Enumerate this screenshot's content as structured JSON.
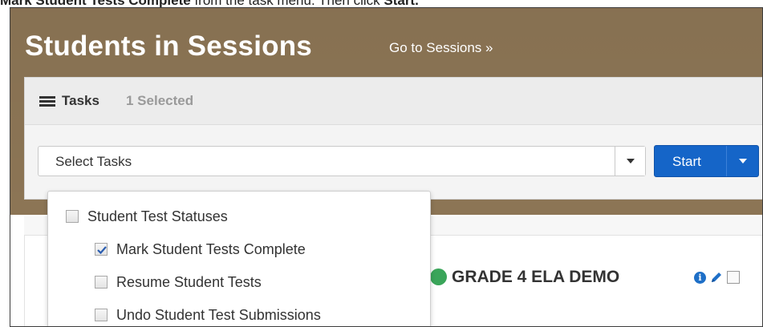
{
  "instruction": {
    "bold": "Mark Student Tests Complete",
    "rest": " from the task menu. Then click ",
    "start_word": "Start."
  },
  "header": {
    "title": "Students in Sessions",
    "link": "Go to Sessions »"
  },
  "tasks": {
    "label": "Tasks",
    "selected_count": "1 Selected",
    "select_placeholder": "Select Tasks",
    "start_label": "Start"
  },
  "menu": {
    "group_label": "Student Test Statuses",
    "items": [
      {
        "label": "Mark Student Tests Complete",
        "checked": true
      },
      {
        "label": "Resume Student Tests",
        "checked": false
      },
      {
        "label": "Undo Student Test Submissions",
        "checked": false
      }
    ]
  },
  "session": {
    "title": "GRADE 4 ELA DEMO",
    "status_color": "#3aa55a"
  },
  "colors": {
    "band": "#8c7555",
    "primary": "#1565c8"
  },
  "icons": {
    "tasks": "list-icon",
    "info": "info-icon",
    "edit": "pencil-icon"
  }
}
